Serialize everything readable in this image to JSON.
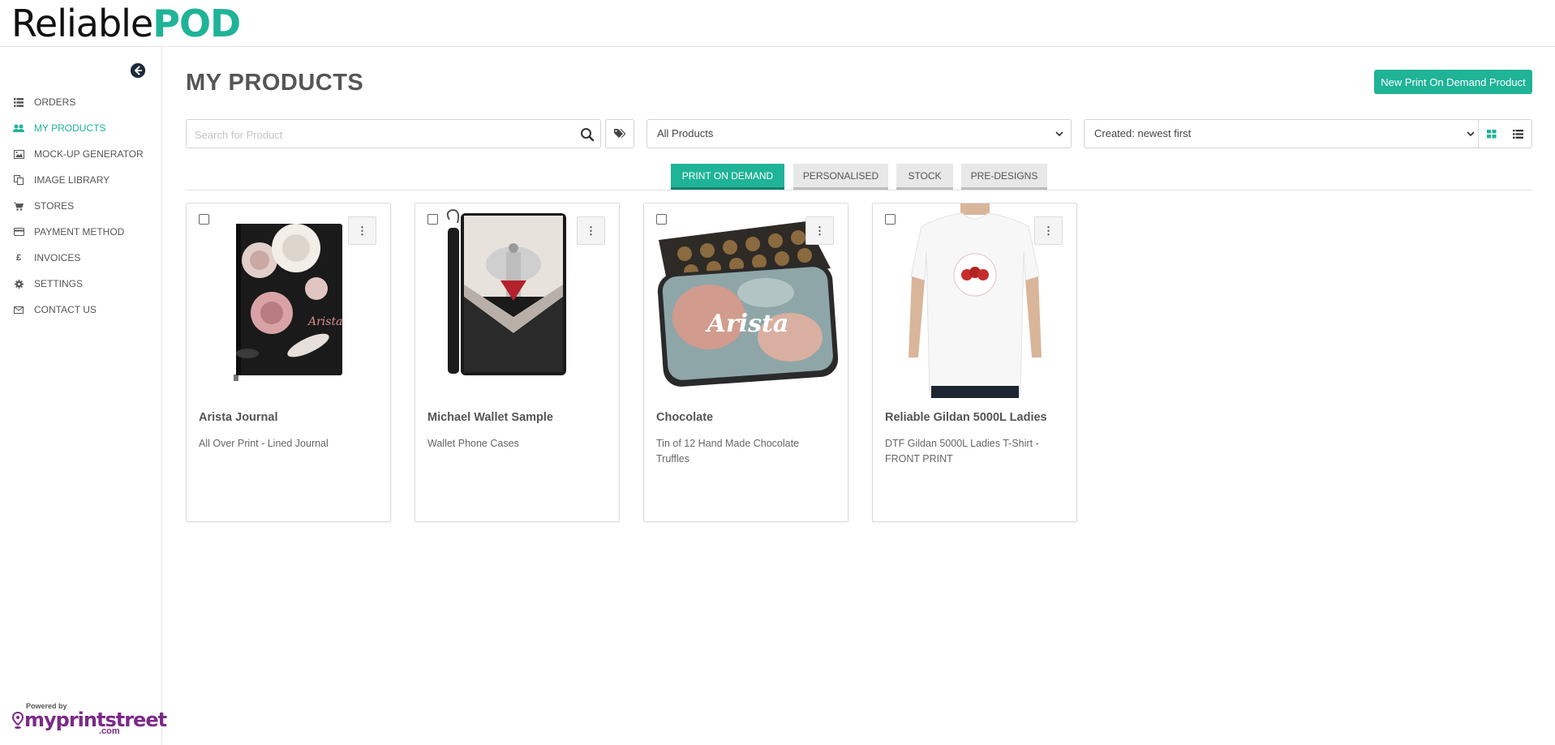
{
  "brand": {
    "part1": "Reliable",
    "part2": "POD"
  },
  "sidebar": {
    "items": [
      {
        "label": "ORDERS",
        "icon": "list-icon",
        "active": false
      },
      {
        "label": "MY PRODUCTS",
        "icon": "users-icon",
        "active": true
      },
      {
        "label": "MOCK-UP GENERATOR",
        "icon": "image-icon",
        "active": false
      },
      {
        "label": "IMAGE LIBRARY",
        "icon": "copy-icon",
        "active": false
      },
      {
        "label": "STORES",
        "icon": "cart-icon",
        "active": false
      },
      {
        "label": "PAYMENT METHOD",
        "icon": "credit-card-icon",
        "active": false
      },
      {
        "label": "INVOICES",
        "icon": "pound-icon",
        "active": false
      },
      {
        "label": "SETTINGS",
        "icon": "gear-icon",
        "active": false
      },
      {
        "label": "CONTACT US",
        "icon": "envelope-icon",
        "active": false
      }
    ],
    "powered_by": "Powered by",
    "powered_brand": "myprintstreet",
    "powered_tld": ".com"
  },
  "main": {
    "title": "MY PRODUCTS",
    "new_button": "New Print On Demand Product",
    "search_placeholder": "Search for Product",
    "filter_selected": "All Products",
    "sort_selected": "Created: newest first",
    "tabs": [
      {
        "label": "PRINT ON DEMAND",
        "active": true
      },
      {
        "label": "PERSONALISED",
        "active": false
      },
      {
        "label": "STOCK",
        "active": false
      },
      {
        "label": "PRE-DESIGNS",
        "active": false
      }
    ],
    "products": [
      {
        "name": "Arista Journal",
        "desc": "All Over Print - Lined Journal"
      },
      {
        "name": "Michael Wallet Sample",
        "desc": "Wallet Phone Cases"
      },
      {
        "name": "Chocolate",
        "desc": "Tin of 12 Hand Made Chocolate Truffles",
        "tin_text": "Arista"
      },
      {
        "name": "Reliable Gildan 5000L Ladies",
        "desc": "DTF Gildan 5000L Ladies T-Shirt - FRONT PRINT"
      }
    ]
  },
  "colors": {
    "accent": "#1fb397",
    "brand_purple": "#7b2a88"
  }
}
